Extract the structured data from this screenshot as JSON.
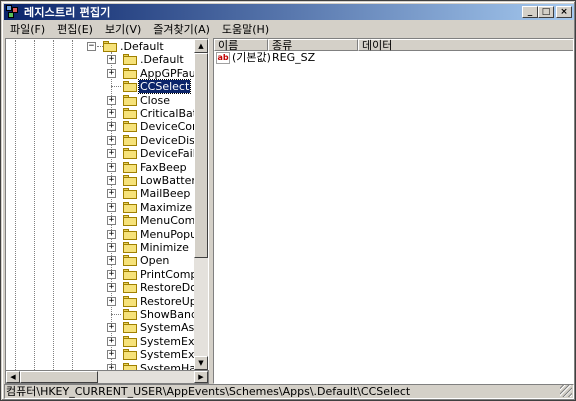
{
  "window": {
    "title": "레지스트리 편집기",
    "buttons": {
      "minimize": "_",
      "maximize": "□",
      "close": "×"
    }
  },
  "menu": [
    {
      "label": "파일(F)"
    },
    {
      "label": "편집(E)"
    },
    {
      "label": "보기(V)"
    },
    {
      "label": "즐겨찾기(A)"
    },
    {
      "label": "도움말(H)"
    }
  ],
  "tree": {
    "parent": {
      "label": ".Default",
      "expanded": true
    },
    "children": [
      {
        "label": ".Default",
        "has_children": true
      },
      {
        "label": "AppGPFault",
        "has_children": true
      },
      {
        "label": "CCSelect",
        "has_children": false,
        "selected": true
      },
      {
        "label": "Close",
        "has_children": true
      },
      {
        "label": "CriticalBatteryA",
        "has_children": true
      },
      {
        "label": "DeviceConnect",
        "has_children": true
      },
      {
        "label": "DeviceDisconn",
        "has_children": true
      },
      {
        "label": "DeviceFail",
        "has_children": true
      },
      {
        "label": "FaxBeep",
        "has_children": true
      },
      {
        "label": "LowBatteryAla",
        "has_children": true
      },
      {
        "label": "MailBeep",
        "has_children": true
      },
      {
        "label": "Maximize",
        "has_children": true
      },
      {
        "label": "MenuComman",
        "has_children": true
      },
      {
        "label": "MenuPopup",
        "has_children": true
      },
      {
        "label": "Minimize",
        "has_children": true
      },
      {
        "label": "Open",
        "has_children": true
      },
      {
        "label": "PrintComplete",
        "has_children": true
      },
      {
        "label": "RestoreDown",
        "has_children": true
      },
      {
        "label": "RestoreUp",
        "has_children": true
      },
      {
        "label": "ShowBand",
        "has_children": false
      },
      {
        "label": "SystemAsteris",
        "has_children": true
      },
      {
        "label": "SystemExclan",
        "has_children": true
      },
      {
        "label": "SystemExit",
        "has_children": true
      },
      {
        "label": "SystemHand",
        "has_children": true
      }
    ]
  },
  "list": {
    "columns": [
      {
        "label": "이름"
      },
      {
        "label": "종류"
      },
      {
        "label": "데이터"
      }
    ],
    "rows": [
      {
        "icon": "ab",
        "name": "(기본값)",
        "type": "REG_SZ",
        "data": ""
      }
    ]
  },
  "statusbar": {
    "path": "컴퓨터\\HKEY_CURRENT_USER\\AppEvents\\Schemes\\Apps\\.Default\\CCSelect"
  },
  "colors": {
    "title_start": "#0a246a",
    "title_end": "#a6caf0",
    "selection": "#0a246a",
    "folder": "#f6e27a",
    "chrome": "#d4d0c8"
  }
}
